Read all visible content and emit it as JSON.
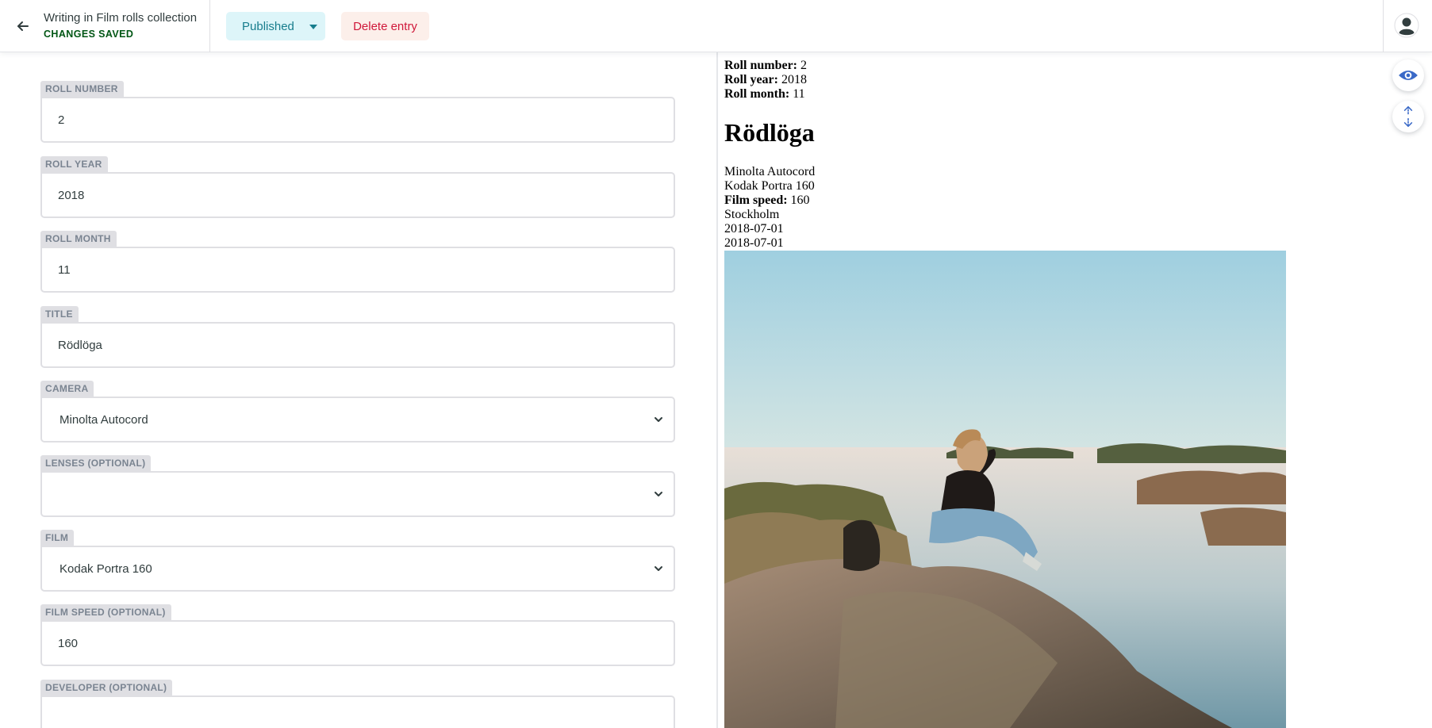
{
  "header": {
    "back_icon": "arrow-left-icon",
    "entry_title": "Writing in Film rolls collection",
    "save_status": "CHANGES SAVED",
    "publish_label": "Published",
    "delete_label": "Delete entry",
    "avatar_icon": "user-avatar-icon",
    "colors": {
      "saved": "#005614",
      "publish_bg": "#ddf5f9",
      "publish_text": "#177d8d",
      "delete_bg": "#fcefea",
      "delete_text": "#d0183a"
    }
  },
  "fields": [
    {
      "label": "ROLL NUMBER",
      "value": "2",
      "type": "text"
    },
    {
      "label": "ROLL YEAR",
      "value": "2018",
      "type": "text"
    },
    {
      "label": "ROLL MONTH",
      "value": "11",
      "type": "text"
    },
    {
      "label": "TITLE",
      "value": "Rödlöga",
      "type": "text"
    },
    {
      "label": "CAMERA",
      "value": "Minolta Autocord",
      "type": "select"
    },
    {
      "label": "LENSES (OPTIONAL)",
      "value": "",
      "type": "select"
    },
    {
      "label": "FILM",
      "value": "Kodak Portra 160",
      "type": "select"
    },
    {
      "label": "FILM SPEED (OPTIONAL)",
      "value": "160",
      "type": "text"
    },
    {
      "label": "DEVELOPER (OPTIONAL)",
      "value": "",
      "type": "text"
    }
  ],
  "preview": {
    "roll_number_label": "Roll number:",
    "roll_number": "2",
    "roll_year_label": "Roll year:",
    "roll_year": "2018",
    "roll_month_label": "Roll month:",
    "roll_month": "11",
    "title": "Rödlöga",
    "camera": "Minolta Autocord",
    "film": "Kodak Portra 160",
    "film_speed_label": "Film speed:",
    "film_speed": "160",
    "location": "Stockholm",
    "date_1": "2018-07-01",
    "date_2": "2018-07-01",
    "photo_icon": "photo-image",
    "toggle_preview_icon": "eye-icon",
    "sync_scroll_icon": "sync-scroll-icon"
  }
}
